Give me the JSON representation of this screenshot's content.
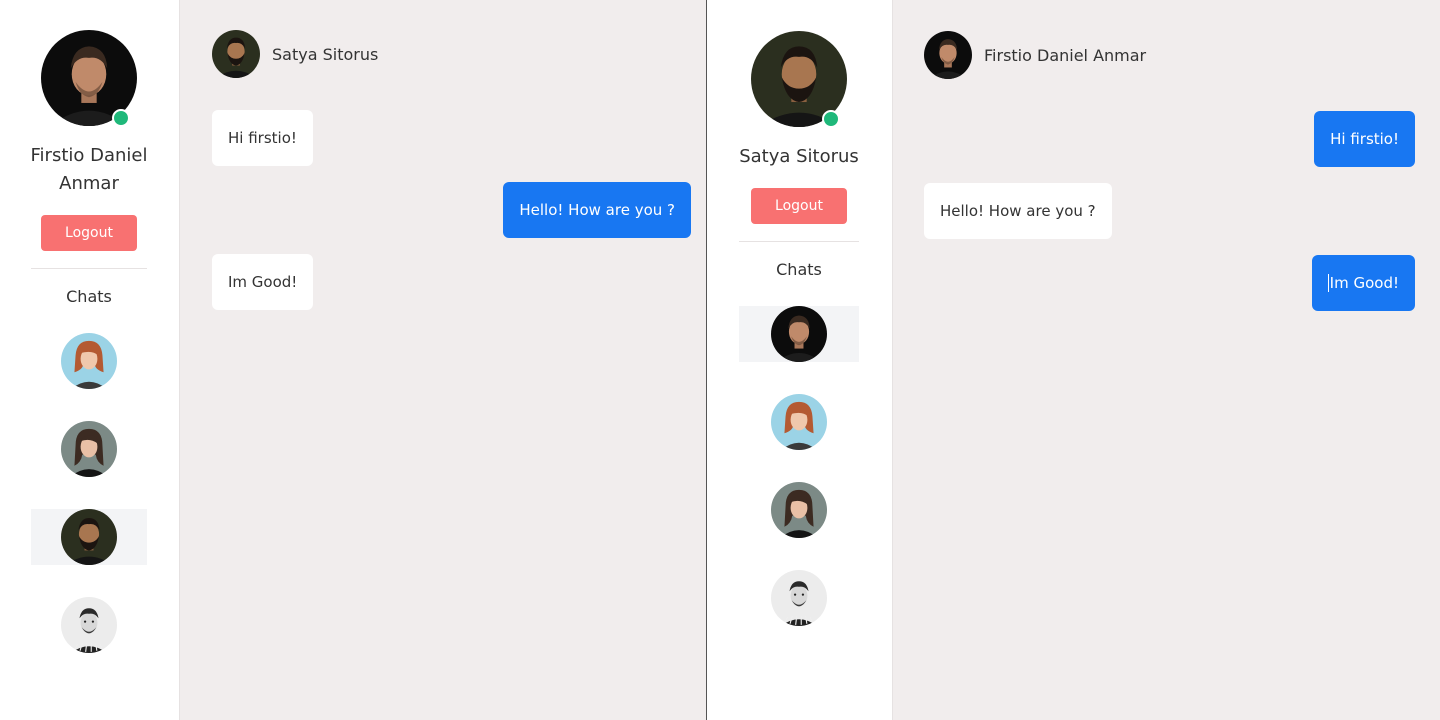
{
  "left_window": {
    "sidebar": {
      "profile_name": "Firstio Daniel Anmar",
      "logout_label": "Logout",
      "chats_label": "Chats",
      "contacts": [
        {
          "avatar": "woman-red-hair-avatar",
          "active": false
        },
        {
          "avatar": "woman-dark-hair-avatar",
          "active": false
        },
        {
          "avatar": "man-beard-avatar",
          "active": true
        },
        {
          "avatar": "man-bw-avatar",
          "active": false
        }
      ]
    },
    "chat": {
      "contact_name": "Satya Sitorus",
      "messages": [
        {
          "text": "Hi firstio!",
          "direction": "in"
        },
        {
          "text": "Hello! How are you ?",
          "direction": "out"
        },
        {
          "text": "Im Good!",
          "direction": "in"
        }
      ]
    }
  },
  "right_window": {
    "sidebar": {
      "profile_name": "Satya Sitorus",
      "logout_label": "Logout",
      "chats_label": "Chats",
      "contacts": [
        {
          "avatar": "man-dark-avatar",
          "active": true
        },
        {
          "avatar": "woman-red-hair-avatar",
          "active": false
        },
        {
          "avatar": "woman-dark-hair-avatar",
          "active": false
        },
        {
          "avatar": "man-bw-avatar",
          "active": false
        }
      ]
    },
    "chat": {
      "contact_name": "Firstio Daniel Anmar",
      "messages": [
        {
          "text": "Hi firstio!",
          "direction": "out"
        },
        {
          "text": "Hello! How are you ?",
          "direction": "in"
        },
        {
          "text": "Im Good!",
          "direction": "out"
        }
      ]
    }
  },
  "colors": {
    "accent": "#1877f2",
    "logout": "#f87171",
    "online": "#1fb87a",
    "chat_bg": "#f1eded"
  }
}
